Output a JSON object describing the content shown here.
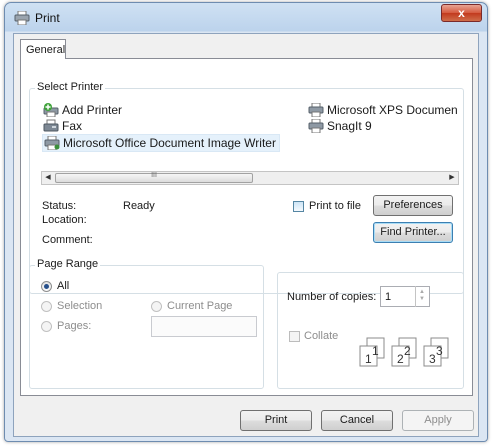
{
  "window": {
    "title": "Print",
    "close_glyph": "x"
  },
  "tabs": [
    {
      "label": "General",
      "active": true
    }
  ],
  "select_printer": {
    "label": "Select Printer",
    "printers": [
      {
        "name": "Add Printer",
        "icon": "add-printer-icon"
      },
      {
        "name": "Fax",
        "icon": "fax-printer-icon"
      },
      {
        "name": "Microsoft Office Document Image Writer",
        "icon": "printer-icon",
        "selected": true
      },
      {
        "name": "Microsoft XPS Documen",
        "icon": "printer-icon"
      },
      {
        "name": "SnagIt 9",
        "icon": "printer-icon"
      }
    ],
    "scroll_thumb_glyph": "III"
  },
  "status": {
    "status_label": "Status:",
    "status_value": "Ready",
    "location_label": "Location:",
    "location_value": "",
    "comment_label": "Comment:",
    "comment_value": "",
    "print_to_file_label": "Print to file",
    "print_to_file_checked": false,
    "preferences_label": "Preferences",
    "find_printer_label": "Find Printer..."
  },
  "page_range": {
    "label": "Page Range",
    "all_label": "All",
    "all_checked": true,
    "selection_label": "Selection",
    "current_page_label": "Current Page",
    "pages_label": "Pages:",
    "pages_value": ""
  },
  "copies": {
    "label": "Number of copies:",
    "value": "1",
    "collate_label": "Collate",
    "collate_checked": false,
    "collate_pages": [
      "1",
      "1",
      "2",
      "2",
      "3",
      "3"
    ]
  },
  "footer": {
    "print_label": "Print",
    "cancel_label": "Cancel",
    "apply_label": "Apply"
  },
  "colors": {
    "title_gradient_top": "#cfe1f3",
    "frame": "#dbe6f3",
    "close_red": "#c23a1e",
    "selection": "#e5f1fb",
    "focus_border": "#3c7fb1"
  }
}
